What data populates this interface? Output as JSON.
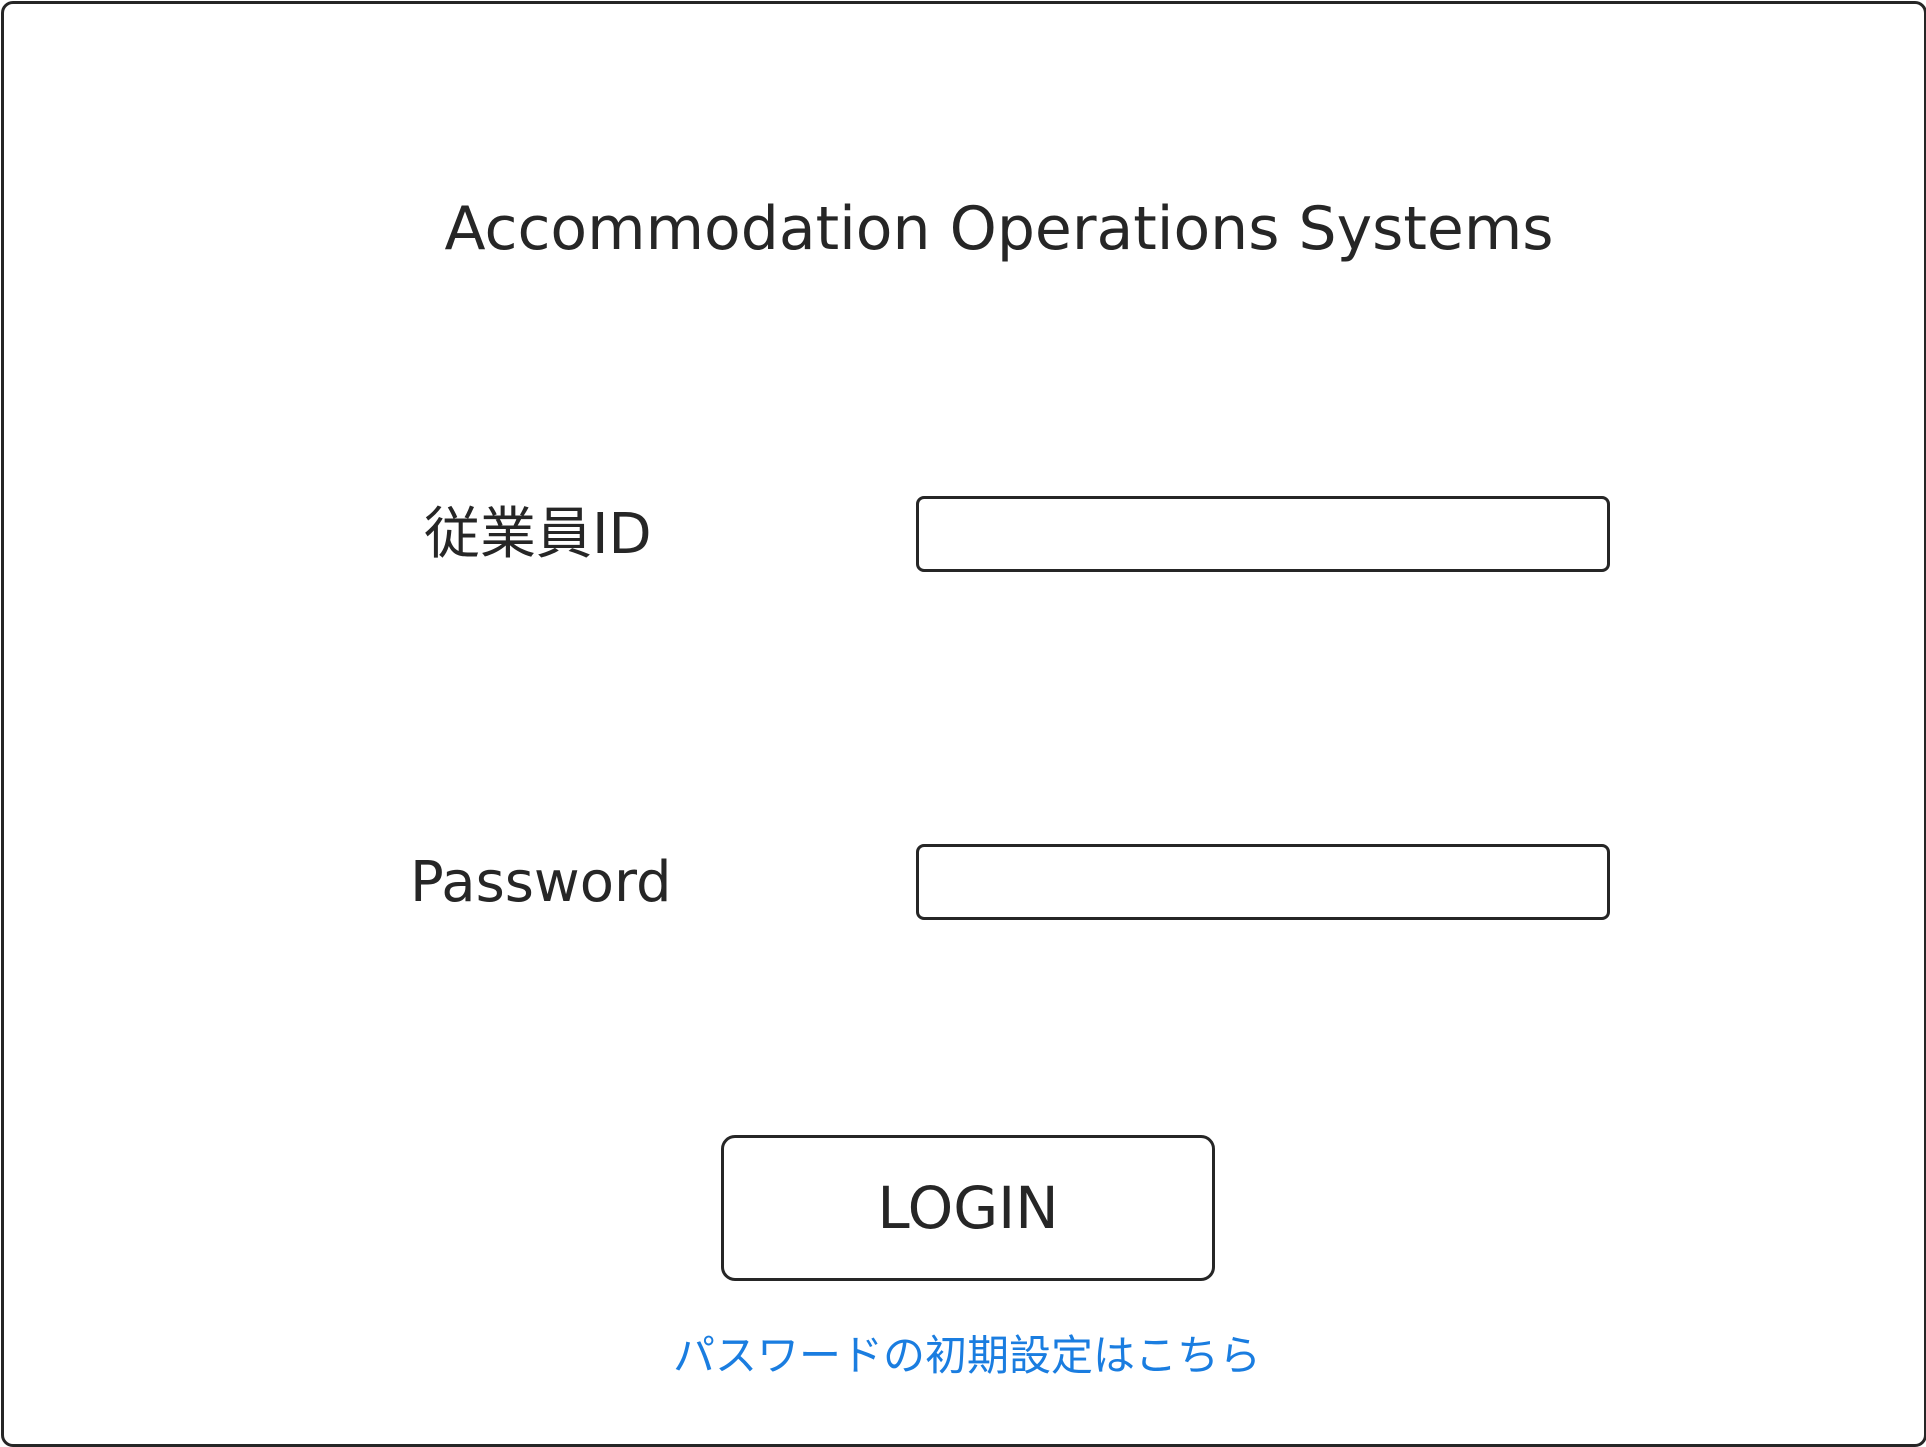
{
  "app": {
    "title": "Accommodation Operations Systems"
  },
  "form": {
    "employee_id": {
      "label": "従業員ID",
      "value": "",
      "placeholder": ""
    },
    "password": {
      "label": "Password",
      "value": "",
      "placeholder": ""
    },
    "login_label": "LOGIN",
    "reset_link_text": "パスワードの初期設定はこちら"
  },
  "colors": {
    "text": "#262626",
    "border": "#262626",
    "link": "#1a7de0",
    "background": "#ffffff"
  }
}
